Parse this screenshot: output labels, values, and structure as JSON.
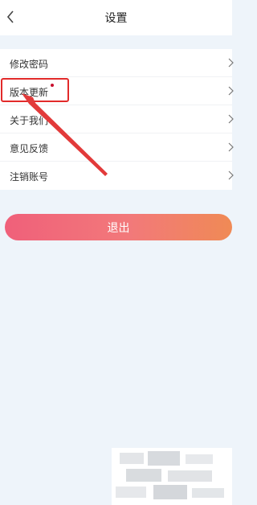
{
  "header": {
    "title": "设置"
  },
  "menu": {
    "items": [
      {
        "label": "修改密码"
      },
      {
        "label": "版本更新",
        "has_dot": true
      },
      {
        "label": "关于我们"
      },
      {
        "label": "意见反馈"
      },
      {
        "label": "注销账号"
      }
    ]
  },
  "logout": {
    "label": "退出"
  },
  "colors": {
    "background": "#eef4fa",
    "dot": "#c8102e",
    "highlight": "#e22a2a",
    "button_start": "#f0607a",
    "button_end": "#f08a55"
  },
  "icons": {
    "back": "chevron-left-icon",
    "item_arrow": "chevron-right-icon"
  }
}
